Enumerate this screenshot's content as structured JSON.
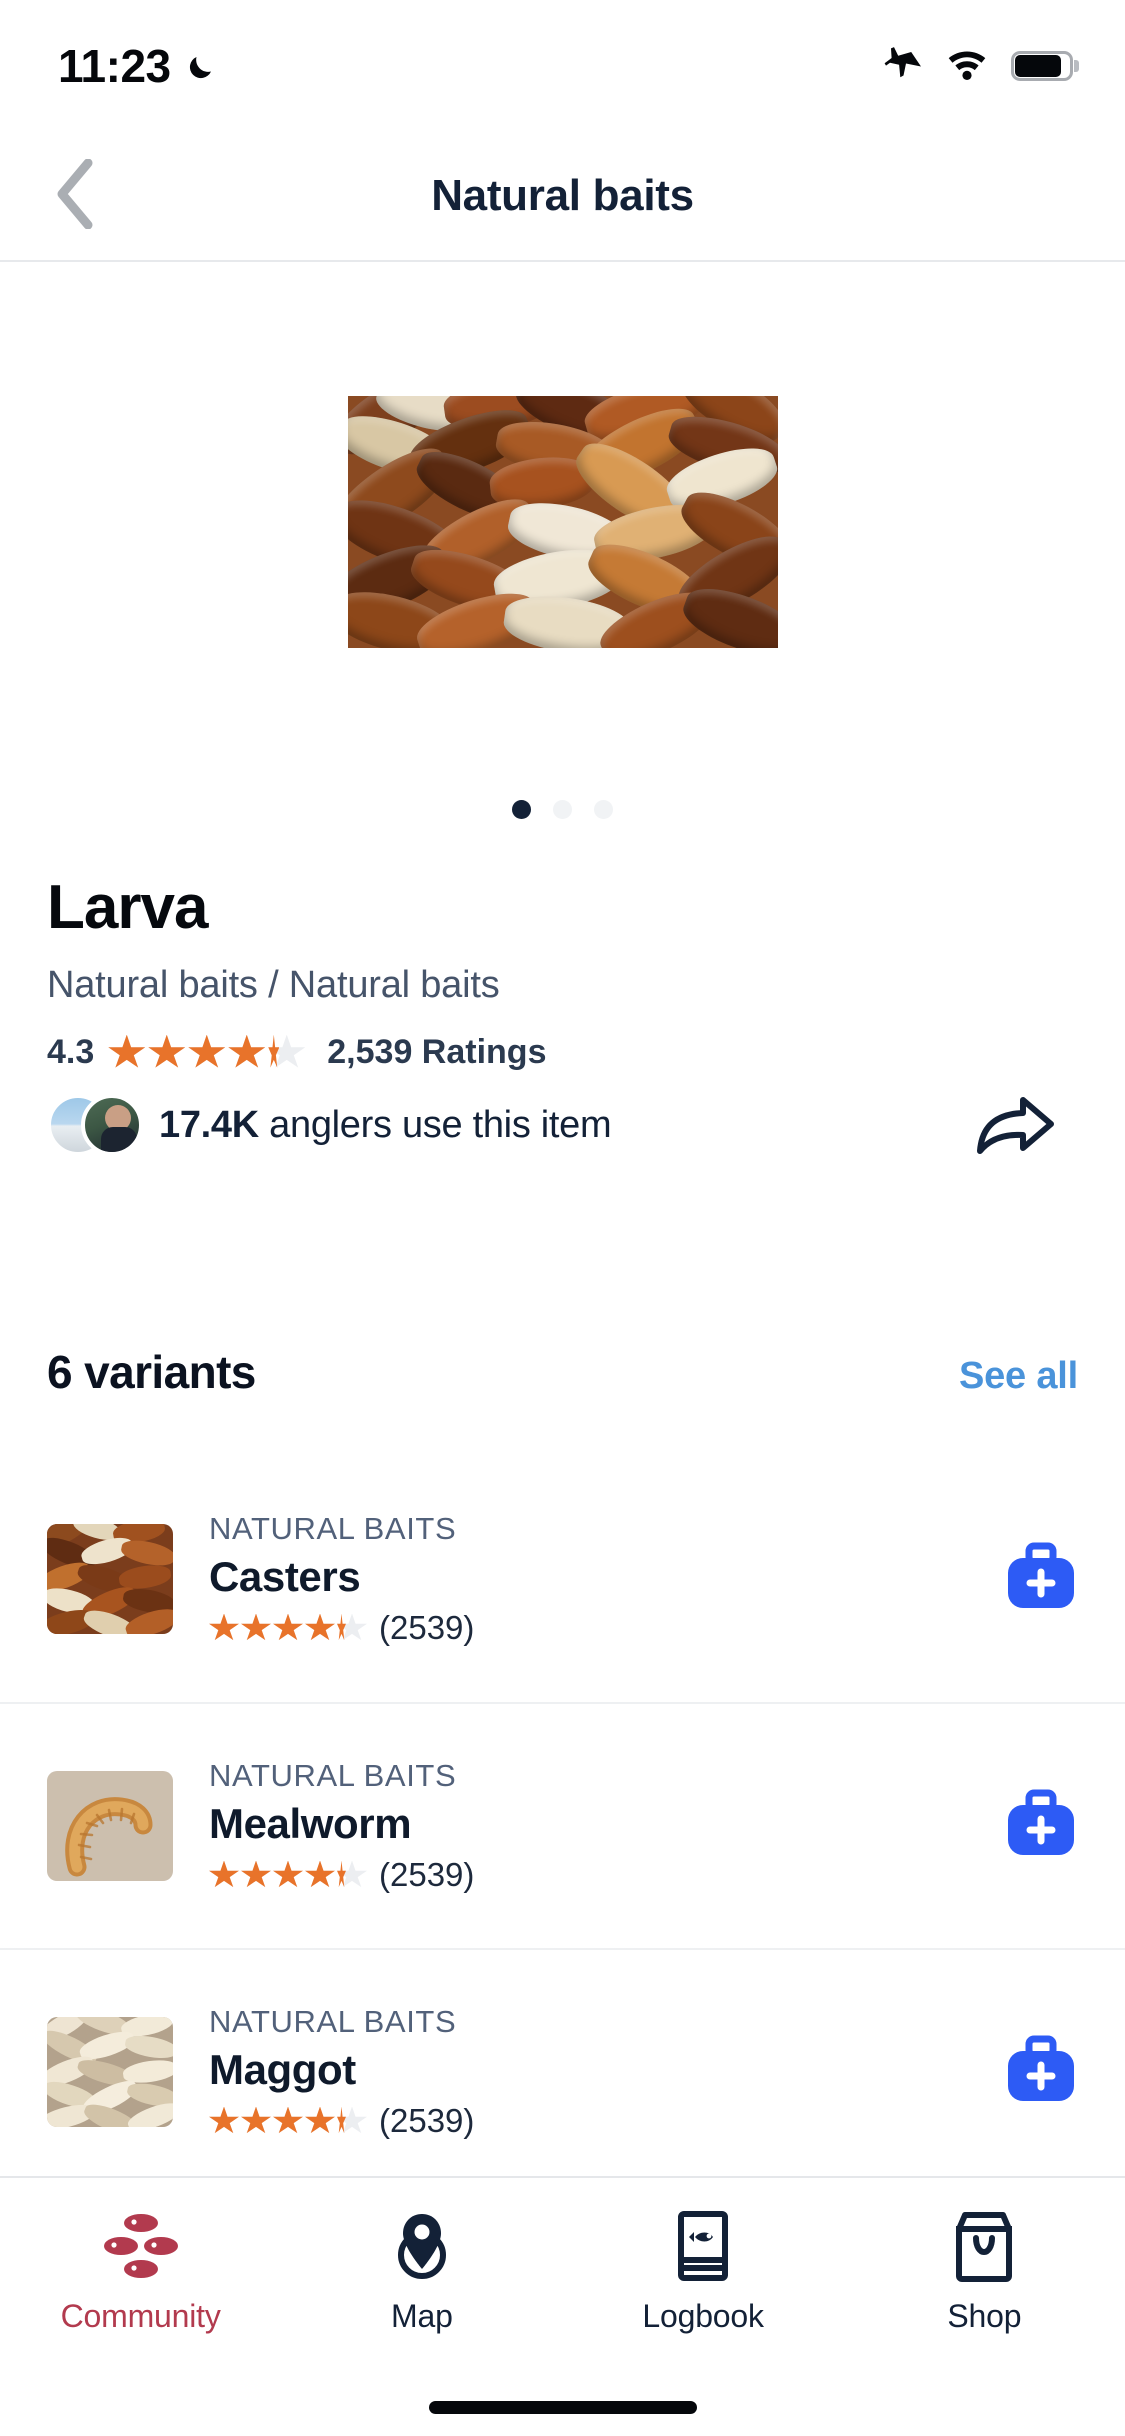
{
  "status_bar": {
    "time": "11:23",
    "icons": [
      "moon-icon",
      "airplane-mode-icon",
      "wifi-icon",
      "battery-icon"
    ],
    "battery_level": 78
  },
  "header": {
    "title": "Natural baits",
    "back_icon": "chevron-left-icon"
  },
  "gallery": {
    "image_alt": "Larva casters close-up",
    "page_count": 3,
    "active_page": 1
  },
  "product": {
    "name": "Larva",
    "category_path": "Natural baits / Natural baits",
    "rating_value": "4.3",
    "rating_fraction": 0.86,
    "ratings_label": "2,539 Ratings",
    "anglers_count": "17.4K",
    "anglers_suffix": " anglers use this item",
    "share_icon": "share-arrow-icon"
  },
  "variants_section": {
    "title": "6 variants",
    "see_all_label": "See all",
    "items": [
      {
        "category": "NATURAL BAITS",
        "name": "Casters",
        "rating_fraction": 0.86,
        "reviews": "(2539)",
        "thumb": "casters-thumbnail",
        "add_icon": "tacklebox-plus-icon"
      },
      {
        "category": "NATURAL BAITS",
        "name": "Mealworm",
        "rating_fraction": 0.86,
        "reviews": "(2539)",
        "thumb": "mealworm-thumbnail",
        "add_icon": "tacklebox-plus-icon"
      },
      {
        "category": "NATURAL BAITS",
        "name": "Maggot",
        "rating_fraction": 0.86,
        "reviews": "(2539)",
        "thumb": "maggot-thumbnail",
        "add_icon": "tacklebox-plus-icon"
      }
    ]
  },
  "tabbar": {
    "active_index": 0,
    "items": [
      {
        "label": "Community",
        "icon": "fish-scales-icon"
      },
      {
        "label": "Map",
        "icon": "map-pin-icon"
      },
      {
        "label": "Logbook",
        "icon": "logbook-fish-icon"
      },
      {
        "label": "Shop",
        "icon": "shopping-bag-icon"
      }
    ]
  },
  "colors": {
    "accent_blue": "#2d5bf5",
    "link_blue": "#4a93da",
    "star_orange": "#e8732a",
    "active_tab_red": "#b23a4e",
    "navy_text": "#132137"
  }
}
